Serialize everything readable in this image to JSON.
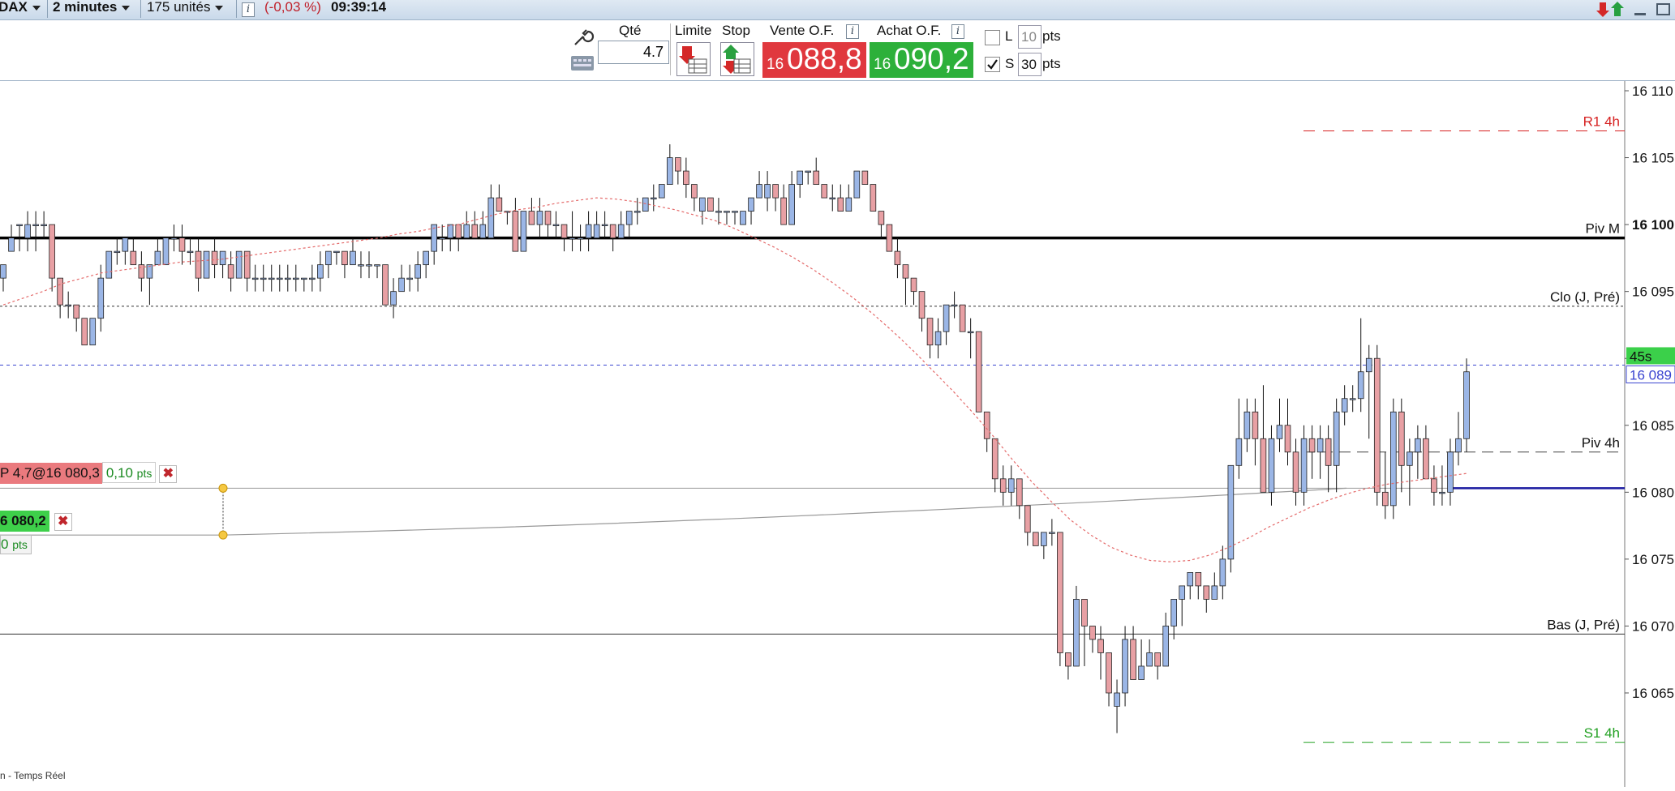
{
  "header": {
    "instrument": "DAX",
    "timeframe": "2 minutes",
    "units": "175 unités",
    "info_glyph": "i",
    "change": "(-0,03 %)",
    "time": "09:39:14"
  },
  "trade_panel": {
    "qty_label": "Qté",
    "qty_value": "4.7",
    "limit_label": "Limite",
    "stop_label": "Stop",
    "sell_label": "Vente O.F.",
    "buy_label": "Achat O.F.",
    "sell_prefix": "16",
    "sell_price": "088,8",
    "buy_prefix": "16",
    "buy_price": "090,2",
    "l_label": "L",
    "l_value": "10",
    "l_unit": "pts",
    "s_label": "S",
    "s_value": "30",
    "s_unit": "pts",
    "s_checked": true,
    "l_checked": false
  },
  "orders": {
    "position_tag": "P 4,7@16 080,3",
    "position_pts": "0,10",
    "position_pts_unit": "pts",
    "stop_tag": "6 080,2",
    "stop_pts": "0",
    "stop_pts_unit": "pts",
    "close_glyph": "✖"
  },
  "footer_text": "n - Temps Réel",
  "colors": {
    "bull": "#9bb6e6",
    "bear": "#e8a0a4",
    "sell": "#e0383e",
    "buy": "#2db03a",
    "r1": "#d62020",
    "s1": "#22a022",
    "current": "#3a45d0",
    "navy": "#1a1aa0"
  },
  "chart_data": {
    "type": "candlestick",
    "instrument": "DAX",
    "timeframe": "2 minutes",
    "y_ticks": [
      "16 110",
      "16 105",
      "16 100",
      "16 095",
      "16 090",
      "16 085",
      "16 080",
      "16 075",
      "16 070",
      "16 065"
    ],
    "ylim": [
      16061,
      16111
    ],
    "current_price": 16089.5,
    "current_price_label": "16 089",
    "countdown_label": "45s",
    "levels": [
      {
        "name": "R1 4h",
        "value": 16107
      },
      {
        "name": "Piv M",
        "value": 16099
      },
      {
        "name": "Clo (J, Pré)",
        "value": 16093.9
      },
      {
        "name": "Piv 4h",
        "value": 16083
      },
      {
        "name": "Bas (J, Pré)",
        "value": 16069.4
      },
      {
        "name": "S1 4h",
        "value": 16061.3
      }
    ],
    "position_line": 16080.3,
    "stop_line": 16076.8,
    "candles": [
      [
        16096,
        16097,
        16095,
        16097
      ],
      [
        16098,
        16100,
        16098,
        16099
      ],
      [
        16100,
        16100,
        16098,
        16100
      ],
      [
        16099,
        16101,
        16098,
        16100
      ],
      [
        16100,
        16101,
        16098,
        16100
      ],
      [
        16100,
        16101,
        16099,
        16100
      ],
      [
        16100,
        16100,
        16095,
        16096
      ],
      [
        16096,
        16096,
        16093,
        16094
      ],
      [
        16094,
        16095,
        16093,
        16094
      ],
      [
        16094,
        16094,
        16092,
        16093
      ],
      [
        16093,
        16093,
        16091,
        16091
      ],
      [
        16091,
        16093,
        16091,
        16093
      ],
      [
        16093,
        16097,
        16092,
        16096
      ],
      [
        16096,
        16098,
        16096,
        16098
      ],
      [
        16098,
        16099,
        16097,
        16098
      ],
      [
        16098,
        16099,
        16097,
        16099
      ],
      [
        16098,
        16099,
        16097,
        16097
      ],
      [
        16097,
        16098,
        16095,
        16096
      ],
      [
        16096,
        16097,
        16094,
        16097
      ],
      [
        16097,
        16099,
        16097,
        16098
      ],
      [
        16097,
        16099,
        16097,
        16099
      ],
      [
        16099,
        16100,
        16098,
        16099
      ],
      [
        16099,
        16100,
        16097,
        16098
      ],
      [
        16098,
        16099,
        16097,
        16098
      ],
      [
        16098,
        16099,
        16095,
        16096
      ],
      [
        16096,
        16098,
        16096,
        16098
      ],
      [
        16098,
        16099,
        16096,
        16097
      ],
      [
        16097,
        16098,
        16096,
        16098
      ],
      [
        16097,
        16098,
        16095,
        16096
      ],
      [
        16096,
        16098,
        16096,
        16098
      ],
      [
        16098,
        16098,
        16095,
        16096
      ],
      [
        16096,
        16097,
        16095,
        16096
      ],
      [
        16096,
        16097,
        16095,
        16096
      ],
      [
        16096,
        16097,
        16095,
        16096
      ],
      [
        16096,
        16097,
        16095,
        16096
      ],
      [
        16096,
        16097,
        16095,
        16096
      ],
      [
        16096,
        16097,
        16095,
        16096
      ],
      [
        16096,
        16096,
        16095,
        16096
      ],
      [
        16096,
        16097,
        16095,
        16096
      ],
      [
        16096,
        16098,
        16095,
        16097
      ],
      [
        16097,
        16098,
        16096,
        16098
      ],
      [
        16098,
        16098,
        16097,
        16098
      ],
      [
        16098,
        16098,
        16096,
        16097
      ],
      [
        16097,
        16099,
        16097,
        16098
      ],
      [
        16097,
        16098,
        16096,
        16097
      ],
      [
        16097,
        16098,
        16096,
        16097
      ],
      [
        16097,
        16097,
        16096,
        16097
      ],
      [
        16097,
        16097,
        16094,
        16094
      ],
      [
        16094,
        16096,
        16093,
        16095
      ],
      [
        16095,
        16097,
        16095,
        16096
      ],
      [
        16096,
        16097,
        16095,
        16096
      ],
      [
        16096,
        16098,
        16095,
        16097
      ],
      [
        16097,
        16098,
        16096,
        16098
      ],
      [
        16098,
        16100,
        16097,
        16100
      ],
      [
        16099,
        16100,
        16098,
        16099
      ],
      [
        16099,
        16100,
        16098,
        16100
      ],
      [
        16100,
        16100,
        16098,
        16099
      ],
      [
        16099,
        16101,
        16099,
        16100
      ],
      [
        16100,
        16101,
        16099,
        16099
      ],
      [
        16099,
        16101,
        16099,
        16100
      ],
      [
        16099,
        16103,
        16099,
        16102
      ],
      [
        16102,
        16103,
        16101,
        16101
      ],
      [
        16101,
        16101,
        16100,
        16101
      ],
      [
        16101,
        16102,
        16098,
        16098
      ],
      [
        16098,
        16101,
        16098,
        16101
      ],
      [
        16101,
        16102,
        16100,
        16100
      ],
      [
        16100,
        16102,
        16099,
        16101
      ],
      [
        16101,
        16101,
        16099,
        16100
      ],
      [
        16100,
        16101,
        16099,
        16100
      ],
      [
        16100,
        16100,
        16098,
        16099
      ],
      [
        16099,
        16101,
        16098,
        16099
      ],
      [
        16099,
        16100,
        16098,
        16099
      ],
      [
        16099,
        16101,
        16098,
        16100
      ],
      [
        16099,
        16101,
        16099,
        16100
      ],
      [
        16100,
        16101,
        16099,
        16100
      ],
      [
        16100,
        16100,
        16098,
        16099
      ],
      [
        16099,
        16101,
        16099,
        16100
      ],
      [
        16100,
        16101,
        16099,
        16101
      ],
      [
        16101,
        16102,
        16100,
        16101
      ],
      [
        16101,
        16102,
        16101,
        16102
      ],
      [
        16102,
        16103,
        16101,
        16102
      ],
      [
        16102,
        16103,
        16102,
        16103
      ],
      [
        16103,
        16106,
        16103,
        16105
      ],
      [
        16105,
        16105,
        16103,
        16104
      ],
      [
        16104,
        16105,
        16102,
        16103
      ],
      [
        16103,
        16103,
        16101,
        16102
      ],
      [
        16101,
        16102,
        16100,
        16102
      ],
      [
        16102,
        16102,
        16101,
        16101
      ],
      [
        16101,
        16102,
        16100,
        16101
      ],
      [
        16101,
        16101,
        16100,
        16101
      ],
      [
        16101,
        16101,
        16100,
        16101
      ],
      [
        16100,
        16101,
        16100,
        16101
      ],
      [
        16101,
        16102,
        16100,
        16102
      ],
      [
        16102,
        16104,
        16102,
        16103
      ],
      [
        16102,
        16104,
        16101,
        16103
      ],
      [
        16103,
        16103,
        16101,
        16102
      ],
      [
        16102,
        16103,
        16100,
        16100
      ],
      [
        16100,
        16104,
        16100,
        16103
      ],
      [
        16103,
        16104,
        16102,
        16104
      ],
      [
        16104,
        16104,
        16103,
        16104
      ],
      [
        16104,
        16105,
        16103,
        16103
      ],
      [
        16103,
        16103,
        16102,
        16102
      ],
      [
        16102,
        16103,
        16101,
        16102
      ],
      [
        16102,
        16103,
        16101,
        16101
      ],
      [
        16101,
        16103,
        16101,
        16102
      ],
      [
        16102,
        16104,
        16102,
        16104
      ],
      [
        16104,
        16104,
        16103,
        16103
      ],
      [
        16103,
        16103,
        16101,
        16101
      ],
      [
        16101,
        16101,
        16099,
        16100
      ],
      [
        16100,
        16100,
        16098,
        16098
      ],
      [
        16098,
        16099,
        16096,
        16097
      ],
      [
        16097,
        16097,
        16094,
        16096
      ],
      [
        16096,
        16096,
        16094,
        16095
      ],
      [
        16095,
        16095,
        16092,
        16093
      ],
      [
        16093,
        16093,
        16090,
        16091
      ],
      [
        16091,
        16093,
        16090,
        16092
      ],
      [
        16092,
        16094,
        16091,
        16094
      ],
      [
        16094,
        16095,
        16093,
        16094
      ],
      [
        16094,
        16094,
        16092,
        16092
      ],
      [
        16092,
        16093,
        16090,
        16092
      ],
      [
        16092,
        16092,
        16086,
        16086
      ],
      [
        16086,
        16086,
        16083,
        16084
      ],
      [
        16084,
        16084,
        16080,
        16081
      ],
      [
        16081,
        16082,
        16079,
        16080
      ],
      [
        16080,
        16082,
        16079,
        16081
      ],
      [
        16081,
        16081,
        16078,
        16079
      ],
      [
        16079,
        16079,
        16076,
        16077
      ],
      [
        16077,
        16077,
        16076,
        16076
      ],
      [
        16076,
        16077,
        16075,
        16077
      ],
      [
        16077,
        16078,
        16076,
        16077
      ],
      [
        16077,
        16077,
        16067,
        16068
      ],
      [
        16068,
        16068,
        16066,
        16067
      ],
      [
        16067,
        16073,
        16067,
        16072
      ],
      [
        16072,
        16072,
        16067,
        16070
      ],
      [
        16070,
        16070,
        16068,
        16069
      ],
      [
        16069,
        16070,
        16066,
        16068
      ],
      [
        16068,
        16068,
        16064,
        16065
      ],
      [
        16064,
        16066,
        16062,
        16065
      ],
      [
        16065,
        16070,
        16064,
        16069
      ],
      [
        16069,
        16070,
        16066,
        16066
      ],
      [
        16066,
        16069,
        16066,
        16067
      ],
      [
        16067,
        16069,
        16067,
        16068
      ],
      [
        16068,
        16068,
        16066,
        16067
      ],
      [
        16067,
        16071,
        16067,
        16070
      ],
      [
        16070,
        16072,
        16069,
        16072
      ],
      [
        16072,
        16073,
        16070,
        16073
      ],
      [
        16073,
        16074,
        16072,
        16074
      ],
      [
        16074,
        16074,
        16072,
        16073
      ],
      [
        16073,
        16073,
        16071,
        16072
      ],
      [
        16072,
        16074,
        16072,
        16073
      ],
      [
        16073,
        16076,
        16072,
        16075
      ],
      [
        16075,
        16082,
        16074,
        16082
      ],
      [
        16082,
        16087,
        16081,
        16084
      ],
      [
        16084,
        16087,
        16083,
        16086
      ],
      [
        16086,
        16087,
        16082,
        16084
      ],
      [
        16084,
        16088,
        16080,
        16080
      ],
      [
        16080,
        16085,
        16079,
        16084
      ],
      [
        16084,
        16087,
        16083,
        16085
      ],
      [
        16085,
        16087,
        16082,
        16083
      ],
      [
        16083,
        16084,
        16079,
        16080
      ],
      [
        16080,
        16085,
        16079,
        16084
      ],
      [
        16084,
        16085,
        16081,
        16083
      ],
      [
        16083,
        16085,
        16081,
        16084
      ],
      [
        16084,
        16085,
        16080,
        16082
      ],
      [
        16082,
        16087,
        16080,
        16086
      ],
      [
        16086,
        16088,
        16085,
        16087
      ],
      [
        16087,
        16088,
        16086,
        16087
      ],
      [
        16087,
        16093,
        16086,
        16089
      ],
      [
        16089,
        16091,
        16084,
        16090
      ],
      [
        16090,
        16091,
        16079,
        16080
      ],
      [
        16080,
        16083,
        16078,
        16079
      ],
      [
        16079,
        16087,
        16078,
        16086
      ],
      [
        16086,
        16087,
        16080,
        16082
      ],
      [
        16082,
        16084,
        16079,
        16083
      ],
      [
        16083,
        16085,
        16081,
        16084
      ],
      [
        16084,
        16085,
        16081,
        16081
      ],
      [
        16081,
        16082,
        16079,
        16080
      ],
      [
        16080,
        16082,
        16079,
        16080
      ],
      [
        16080,
        16084,
        16079,
        16083
      ],
      [
        16083,
        16086,
        16082,
        16084
      ],
      [
        16084,
        16090,
        16083,
        16089
      ]
    ],
    "moving_average": [
      16094,
      16094.5,
      16095,
      16095.6,
      16096,
      16096.4,
      16096.6,
      16096.8,
      16097,
      16097.2,
      16097.3,
      16097.4,
      16097.6,
      16097.8,
      16098,
      16098.2,
      16098.4,
      16098.6,
      16098.8,
      16099,
      16099.3,
      16099.5,
      16099.8,
      16100,
      16100.4,
      16100.8,
      16101.1,
      16101.3,
      16101.6,
      16101.8,
      16102,
      16101.9,
      16101.7,
      16101.4,
      16101.1,
      16100.7,
      16100.3,
      16099.7,
      16099,
      16098.3,
      16097.5,
      16096.6,
      16095.6,
      16094.5,
      16093.3,
      16092,
      16090.6,
      16089.1,
      16087.6,
      16086,
      16084.3,
      16082.5,
      16080.8,
      16079.3,
      16077.9,
      16076.8,
      16075.9,
      16075.3,
      16074.9,
      16074.8,
      16074.9,
      16075.3,
      16075.9,
      16076.6,
      16077.4,
      16078.1,
      16078.8,
      16079.4,
      16079.9,
      16080.3,
      16080.6,
      16080.8,
      16081,
      16081.2,
      16081.4
    ]
  }
}
